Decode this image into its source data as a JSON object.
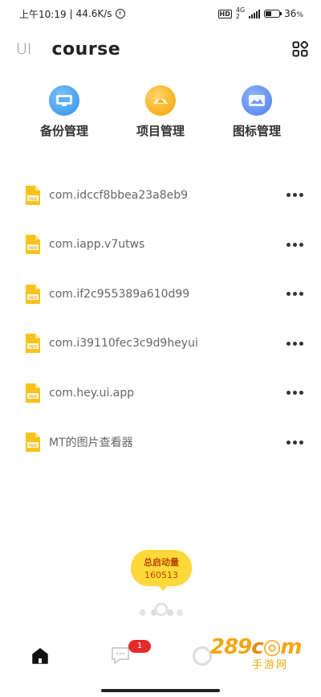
{
  "status_bar": {
    "time": "上午10:19",
    "network_speed": "44.6K/s",
    "hd_badge": "HD",
    "net_type_top": "4G",
    "net_type_bottom": "2",
    "battery_percent": "36",
    "battery_unit": "%"
  },
  "header": {
    "tab_ui": "UI",
    "tab_course": "course",
    "grid_icon": "grid-icon"
  },
  "shortcuts": [
    {
      "label": "备份管理",
      "icon": "backup-icon",
      "color": "#4aa3f0"
    },
    {
      "label": "项目管理",
      "icon": "project-icon",
      "color": "#ffb21e"
    },
    {
      "label": "图标管理",
      "icon": "image-icon",
      "color": "#5a8cf0"
    }
  ],
  "projects": [
    {
      "name": "com.idccf8bbea23a8eb9",
      "icon_text": "iapp"
    },
    {
      "name": "com.iapp.v7utws",
      "icon_text": "iapp"
    },
    {
      "name": "com.if2c955389a610d99",
      "icon_text": "iapp"
    },
    {
      "name": "com.i39110fec3c9d9heyui",
      "icon_text": "iapp"
    },
    {
      "name": "com.hey.ui.app",
      "icon_text": "iapp"
    },
    {
      "name": "MT的图片查看器",
      "icon_text": "iapp"
    }
  ],
  "launch_counter": {
    "title": "总启动量",
    "count": "160513"
  },
  "bottom_nav": {
    "message_badge": "1"
  },
  "watermark": {
    "top_a": "289",
    "top_b": "c",
    "top_c": "m",
    "bottom": "手游网"
  },
  "colors": {
    "accent_yellow": "#ffd83a",
    "file_icon": "#f7c31b",
    "badge_red": "#e32b2b"
  }
}
